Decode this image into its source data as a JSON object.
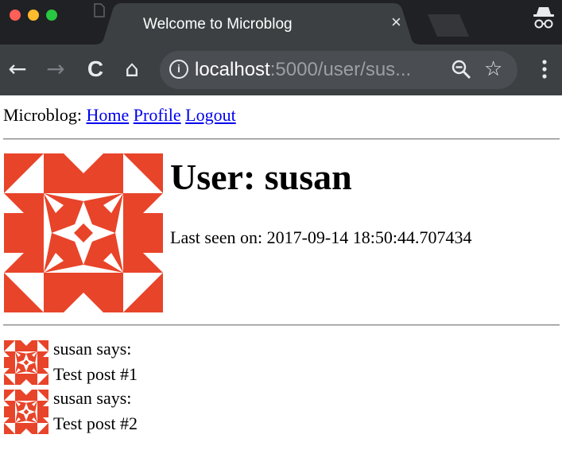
{
  "browser": {
    "tab_title": "Welcome to Microblog",
    "tab_close": "×",
    "url_host": "localhost",
    "url_rest": ":5000/user/sus...",
    "icons": [
      "back-icon",
      "forward-icon",
      "reload-icon",
      "home-icon",
      "info-icon",
      "zoom-icon",
      "star-icon",
      "menu-icon",
      "incognito-icon"
    ],
    "nav_glyphs": {
      "back": "←",
      "forward": "→",
      "reload": "C",
      "home": "⌂",
      "info": "i",
      "star": "☆"
    }
  },
  "page": {
    "brand": "Microblog:",
    "nav_links": [
      {
        "label": "Home"
      },
      {
        "label": "Profile"
      },
      {
        "label": "Logout"
      }
    ],
    "user_heading": "User: susan",
    "last_seen": "Last seen on: 2017-09-14 18:50:44.707434",
    "posts": [
      {
        "author_line": "susan says:",
        "body": "Test post #1"
      },
      {
        "author_line": "susan says:",
        "body": "Test post #2"
      }
    ]
  },
  "colors": {
    "avatar": "#e8442a",
    "link": "#0000ee",
    "titlebar": "#202124",
    "toolbar": "#3c4043",
    "omnibox": "#4a4d51"
  }
}
